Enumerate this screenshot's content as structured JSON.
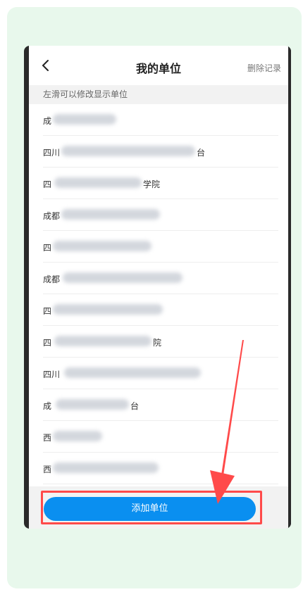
{
  "header": {
    "back_label": "<",
    "title": "我的单位",
    "action": "删除记录"
  },
  "hint": "左滑可以修改显示单位",
  "list": {
    "items": [
      {
        "prefix": "成",
        "suffix": ""
      },
      {
        "prefix": "四川",
        "suffix": "台"
      },
      {
        "prefix": "四",
        "suffix": "学院"
      },
      {
        "prefix": "成都",
        "suffix": ""
      },
      {
        "prefix": "四",
        "suffix": ""
      },
      {
        "prefix": "成都",
        "suffix": ""
      },
      {
        "prefix": "四",
        "suffix": ""
      },
      {
        "prefix": "四",
        "suffix": "院"
      },
      {
        "prefix": "四川",
        "suffix": ""
      },
      {
        "prefix": "成",
        "suffix": "台"
      },
      {
        "prefix": "西",
        "suffix": ""
      },
      {
        "prefix": "西",
        "suffix": ""
      }
    ]
  },
  "footer": {
    "add_button": "添加单位"
  },
  "colors": {
    "accent": "#0a8ff0",
    "highlight": "#ff4a4a",
    "page_bg": "#e8f8ec"
  },
  "annotations": {
    "arrow_icon": "red-arrow-icon",
    "highlight_box": "red-highlight-box"
  }
}
